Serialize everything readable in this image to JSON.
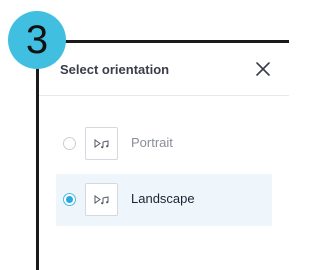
{
  "step_badge": "3",
  "dialog": {
    "title": "Select orientation",
    "close_icon": "close-icon",
    "options": [
      {
        "label": "Portrait",
        "selected": false,
        "icon": "media-icon"
      },
      {
        "label": "Landscape",
        "selected": true,
        "icon": "media-icon"
      }
    ]
  },
  "colors": {
    "badge": "#41bfe0",
    "selected_row": "#eef6fc",
    "radio_selected": "#2aa8e0"
  }
}
